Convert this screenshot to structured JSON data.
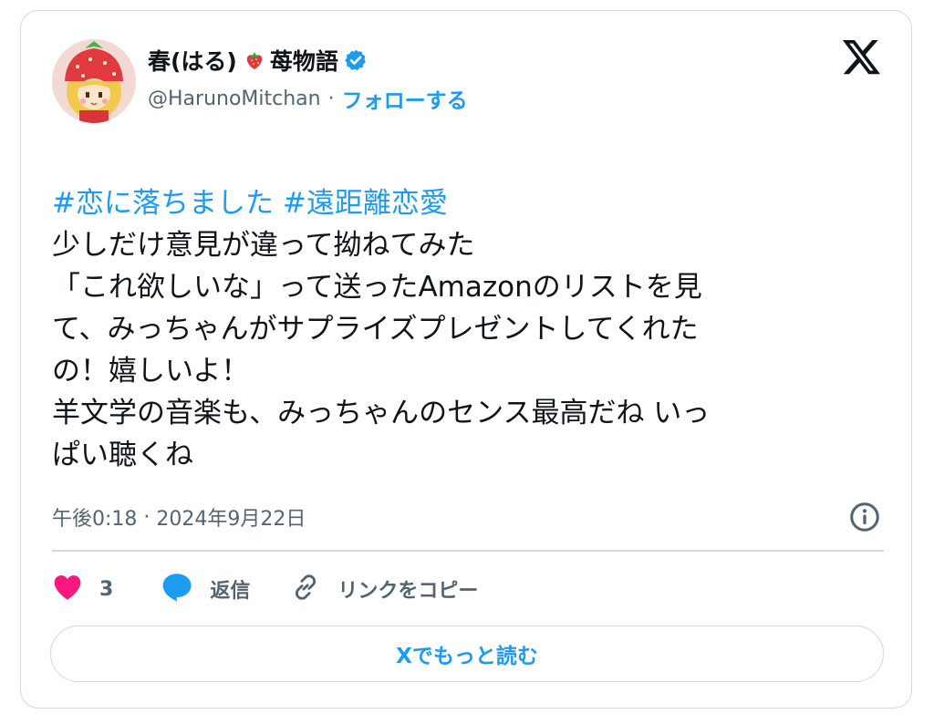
{
  "author": {
    "display_name": "春(はる)",
    "display_name_suffix": "苺物語",
    "emoji_icon": "strawberry-icon",
    "verified": true,
    "handle": "@HarunoMitchan",
    "separator": "·",
    "follow_label": "フォローする"
  },
  "platform_logo": "x-logo-icon",
  "tweet": {
    "hashtags": [
      "#恋に落ちました",
      "#遠距離恋愛"
    ],
    "lines": [
      "少しだけ意見が違って拗ねてみた",
      "「これ欲しいな」って送ったAmazonのリストを見",
      "て、みっちゃんがサプライズプレゼントしてくれた",
      "の！嬉しいよ！",
      "羊文学の音楽も、みっちゃんのセンス最高だね いっ",
      "ぱい聴くね"
    ]
  },
  "meta": {
    "time": "午後0:18",
    "separator": "·",
    "date": "2024年9月22日"
  },
  "actions": {
    "like_count": "3",
    "reply_label": "返信",
    "copy_link_label": "リンクをコピー"
  },
  "read_more_label": "Xでもっと読む",
  "colors": {
    "accent": "#1d9bf0",
    "like": "#f91880",
    "text": "#0f1419",
    "muted": "#536471",
    "border": "#cfd9de"
  }
}
